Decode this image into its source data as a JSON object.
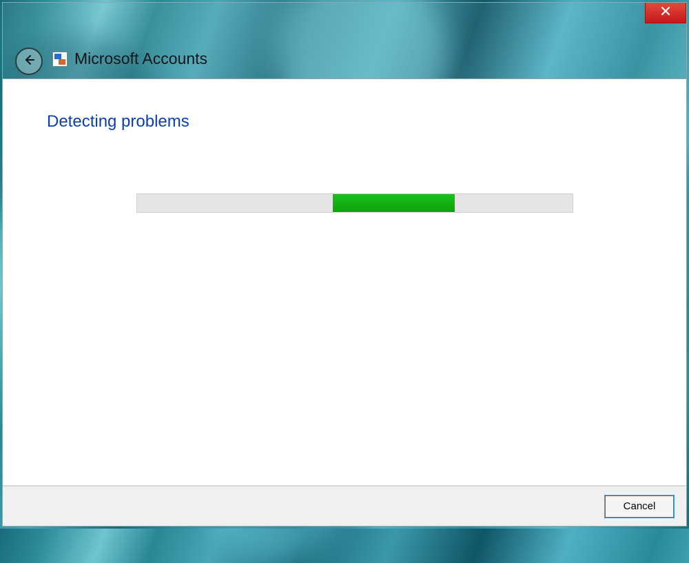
{
  "header": {
    "title": "Microsoft Accounts"
  },
  "content": {
    "status_heading": "Detecting problems",
    "progress": {
      "indeterminate": true,
      "segment_left_pct": 45,
      "segment_width_pct": 28
    }
  },
  "footer": {
    "cancel_label": "Cancel"
  }
}
